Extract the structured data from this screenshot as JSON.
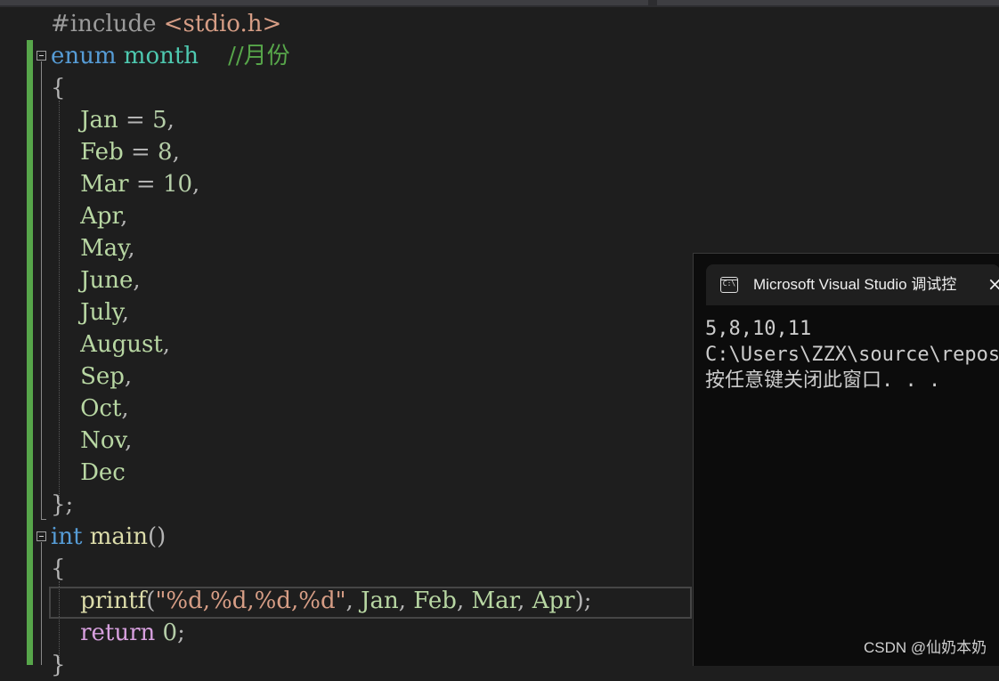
{
  "colors": {
    "background": "#1e1e1e",
    "keyword": "#569cd6",
    "control_keyword": "#d8a0df",
    "type": "#4ec9b0",
    "comment": "#57a64a",
    "enum_member": "#b8d7a3",
    "function": "#dcdcaa",
    "string": "#d69d85",
    "number": "#b5cea8",
    "change_bar": "#57a64a",
    "console_background": "#0c0c0c"
  },
  "code": {
    "include": {
      "directive": "#include",
      "header": " <stdio.h>"
    },
    "enum_decl": {
      "keyword": "enum",
      "name": "month",
      "comment": "//月份"
    },
    "open_brace": "{",
    "members": [
      {
        "name": "Jan",
        "assign": " = ",
        "value": "5",
        "sep": ","
      },
      {
        "name": "Feb",
        "assign": " = ",
        "value": "8",
        "sep": ","
      },
      {
        "name": "Mar",
        "assign": " = ",
        "value": "10",
        "sep": ","
      },
      {
        "name": "Apr",
        "sep": ","
      },
      {
        "name": "May",
        "sep": ","
      },
      {
        "name": "June",
        "sep": ","
      },
      {
        "name": "July",
        "sep": ","
      },
      {
        "name": "August",
        "sep": ","
      },
      {
        "name": "Sep",
        "sep": ","
      },
      {
        "name": "Oct",
        "sep": ","
      },
      {
        "name": "Nov",
        "sep": ","
      },
      {
        "name": "Dec"
      }
    ],
    "close_brace": "};",
    "main_decl": {
      "type": "int",
      "name": "main",
      "params": "()"
    },
    "main_open": "{",
    "printf_stmt": {
      "func": "printf",
      "open": "(",
      "format": "\"%d,%d,%d,%d\"",
      "args": [
        ", ",
        "Jan",
        ", ",
        "Feb",
        ", ",
        "Mar",
        ", ",
        "Apr"
      ],
      "close": ");"
    },
    "return_stmt": {
      "keyword": "return",
      "value": "0",
      "end": ";"
    },
    "main_close": "}"
  },
  "console": {
    "icon": "C:\\",
    "title": "Microsoft Visual Studio 调试控",
    "close": "×",
    "output": [
      "5,8,10,11",
      "C:\\Users\\ZZX\\source\\repos",
      "按任意键关闭此窗口. . ."
    ]
  },
  "watermark": "CSDN @仙奶本奶"
}
